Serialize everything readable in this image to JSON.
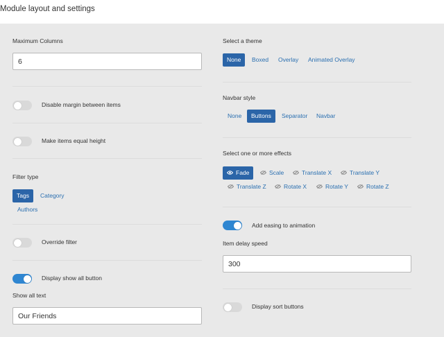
{
  "header": {
    "title": "Module layout and settings"
  },
  "left": {
    "max_columns_label": "Maximum Columns",
    "max_columns_value": "6",
    "disable_margin_label": "Disable margin between items",
    "equal_height_label": "Make items equal height",
    "filter_type_label": "Filter type",
    "filter_types": [
      "Tags",
      "Category",
      "Authors"
    ],
    "override_filter_label": "Override filter",
    "show_all_button_label": "Display show all button",
    "show_all_text_label": "Show all text",
    "show_all_text_value": "Our Friends"
  },
  "right": {
    "theme_label": "Select a theme",
    "themes": [
      "None",
      "Boxed",
      "Overlay",
      "Animated Overlay"
    ],
    "navbar_label": "Navbar style",
    "navbar_styles": [
      "None",
      "Buttons",
      "Separator",
      "Navbar"
    ],
    "effects_label": "Select one or more effects",
    "effects": [
      "Fade",
      "Scale",
      "Translate X",
      "Translate Y",
      "Translate Z",
      "Rotate X",
      "Rotate Y",
      "Rotate Z"
    ],
    "easing_label": "Add easing to animation",
    "delay_label": "Item delay speed",
    "delay_value": "300",
    "sort_buttons_label": "Display sort buttons"
  },
  "colors": {
    "accent": "#2b65a8",
    "toggle_on": "#2f86d1",
    "link": "#2a6fb0"
  }
}
